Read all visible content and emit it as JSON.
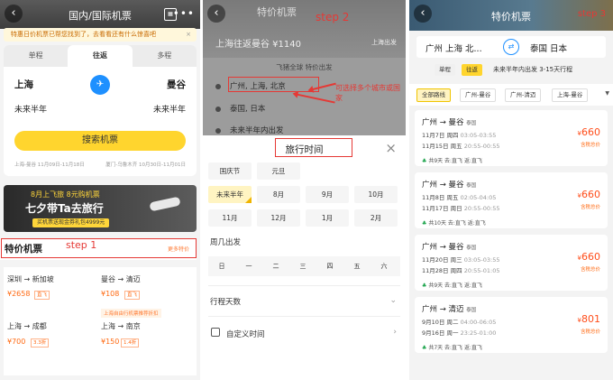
{
  "panel1": {
    "title": "国内/国际机票",
    "notice": "特惠日价机票已帮您找到了，去看看还有什么惊喜吧",
    "tabs": [
      "单程",
      "往返",
      "多程"
    ],
    "from_city": "上海",
    "to_city": "曼谷",
    "depart_date": "未来半年",
    "return_date": "未来半年",
    "search_button": "搜索机票",
    "hint_left": "上海-曼谷 11月09日-11月18日",
    "hint_right": "厦门-乌鲁木齐 10月30日-11月01日",
    "banner_line1": "8月上飞旅 8元购机票",
    "banner_line2": "七夕带Ta去旅行",
    "banner_line3": "买机票送现金券礼包4999元",
    "deal_title": "特价机票",
    "deal_more": "更多特价",
    "step_annotation": "step 1",
    "deals": [
      {
        "route": "深圳 → 新加坡",
        "price": "¥2658",
        "tag": "直飞"
      },
      {
        "route": "曼谷 → 清迈",
        "price": "¥108",
        "tag": "直飞"
      },
      {
        "route": "上海 → 成都",
        "price": "¥700",
        "tag": "3.3折"
      },
      {
        "route": "上海 → 南京",
        "price": "¥150",
        "tag": "1.4折"
      }
    ],
    "promo_text": "上海自由行机票推荐折扣"
  },
  "panel2": {
    "hero_title": "特价机票",
    "step_annotation": "step 2",
    "hero_subtitle": "上海往返曼谷 ¥1140",
    "hero_badge": "上海出发",
    "overlay_header": "飞猪全球 特价出发",
    "options": [
      "广州, 上海, 北京",
      "泰国, 日本",
      "未来半年内出发"
    ],
    "arrow_annotation": "可选择多个城市或国家",
    "sheet_title": "旅行时间",
    "sheet_close": "×",
    "months": [
      "国庆节",
      "元旦",
      "未来半年",
      "8月",
      "9月",
      "10月",
      "11月",
      "12月",
      "1月",
      "2月"
    ],
    "weekday_label": "周几出发",
    "weekdays": [
      "日",
      "一",
      "二",
      "三",
      "四",
      "五",
      "六"
    ],
    "trip_days_label": "行程天数",
    "custom_time_label": "自定义时间"
  },
  "panel3": {
    "title": "特价机票",
    "step_annotation": "step 3",
    "from_cities": "广州 上海 北...",
    "to_countries": "泰国 日本",
    "trip_chips": [
      "单程",
      "往返"
    ],
    "trip_window": "未来半年内出发 3-15天行程",
    "filters": [
      "全部路线",
      "广州-曼谷",
      "广州-清迈",
      "上海-曼谷"
    ],
    "cards": [
      {
        "route": "广州 → 曼谷",
        "country": "泰国",
        "line1_date": "11月7日 周四",
        "line1_time": "03:05-03:55",
        "line2_date": "11月15日 周五",
        "line2_time": "20:55-00:55",
        "price": "660",
        "price_label": "含税总价",
        "footer": "共9天 去:直飞 返:直飞"
      },
      {
        "route": "广州 → 曼谷",
        "country": "泰国",
        "line1_date": "11月8日 周五",
        "line1_time": "02:05-04:05",
        "line2_date": "11月17日 周日",
        "line2_time": "20:55-00:55",
        "price": "660",
        "price_label": "含税总价",
        "footer": "共10天 去:直飞 返:直飞"
      },
      {
        "route": "广州 → 曼谷",
        "country": "泰国",
        "line1_date": "11月20日 周三",
        "line1_time": "03:05-03:55",
        "line2_date": "11月28日 周四",
        "line2_time": "20:55-01:05",
        "price": "660",
        "price_label": "含税总价",
        "footer": "共9天 去:直飞 返:直飞"
      },
      {
        "route": "广州 → 清迈",
        "country": "泰国",
        "line1_date": "9月10日 周二",
        "line1_time": "04:00-06:05",
        "line2_date": "9月16日 周一",
        "line2_time": "23:25-01:00",
        "price": "801",
        "price_label": "含税总价",
        "footer": "共7天 去:直飞 返:直飞"
      }
    ]
  }
}
